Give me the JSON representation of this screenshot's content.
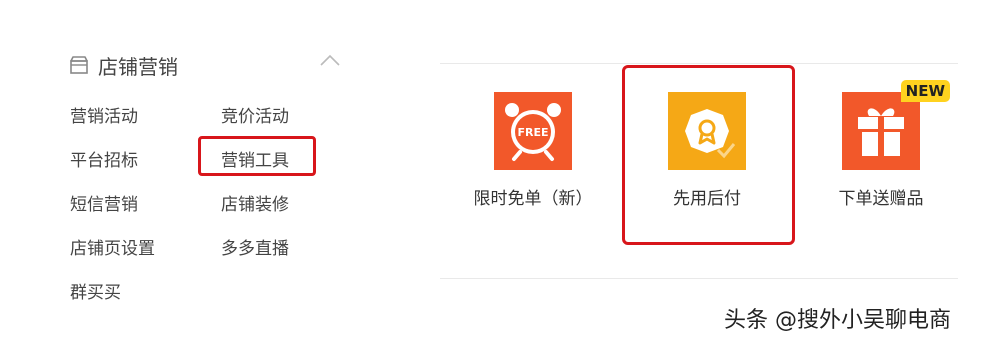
{
  "sidebar": {
    "section_title": "店铺营销",
    "section_icon": "store-icon",
    "collapse_icon": "chevron-up-icon",
    "items": [
      {
        "label": "营销活动"
      },
      {
        "label": "竞价活动"
      },
      {
        "label": "平台招标"
      },
      {
        "label": "营销工具"
      },
      {
        "label": "短信营销"
      },
      {
        "label": "店铺装修"
      },
      {
        "label": "店铺页设置"
      },
      {
        "label": "多多直播"
      },
      {
        "label": "群买买"
      }
    ],
    "highlighted_item": "营销工具"
  },
  "tools": [
    {
      "label": "限时免单（新）",
      "icon": "free-clock-icon",
      "icon_text": "FREE",
      "color": "#f2582a"
    },
    {
      "label": "先用后付",
      "icon": "badge-check-icon",
      "color": "#f5a816",
      "highlighted": true
    },
    {
      "label": "下单送赠品",
      "icon": "gift-icon",
      "color": "#f2582a",
      "badge": "NEW"
    }
  ],
  "colors": {
    "highlight": "#d8161b",
    "badge": "#ffd21f",
    "accent_orange": "#f2582a",
    "accent_yellow": "#f5a816"
  },
  "watermark": "头条 @搜外小吴聊电商"
}
